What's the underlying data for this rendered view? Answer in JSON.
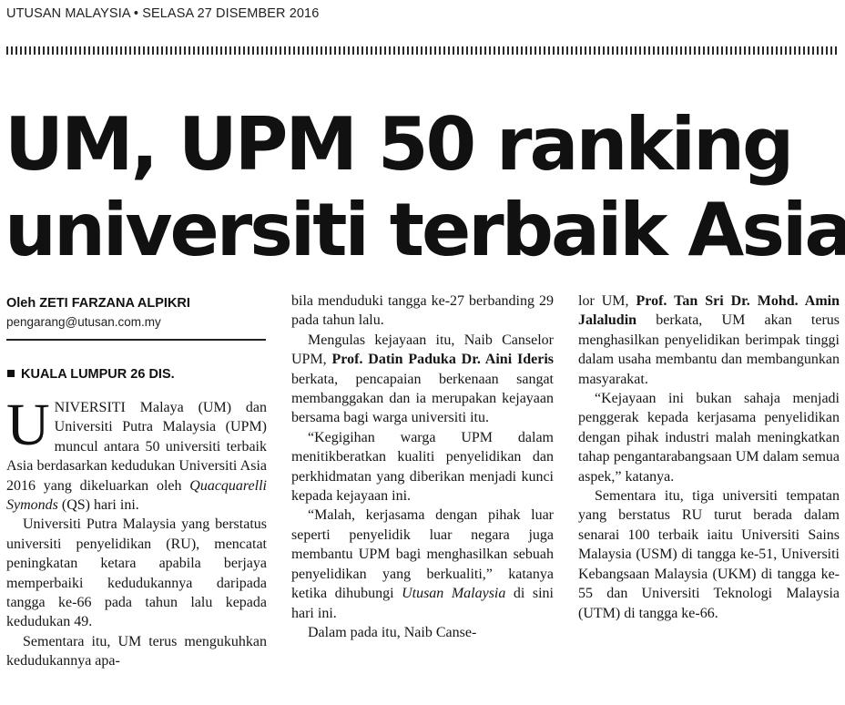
{
  "masthead": "UTUSAN MALAYSIA • SELASA 27 DISEMBER 2016",
  "headline": {
    "line1": "UM, UPM 50 ranking",
    "line2": "universiti terbaik Asia"
  },
  "byline": "Oleh ZETI FARZANA ALPIKRI",
  "email": "pengarang@utusan.com.my",
  "dateline": "KUALA LUMPUR 26 DIS.",
  "col1": {
    "dropcap": "U",
    "p1a": "NIVERSITI Malaya (UM) dan Universiti Putra Malaysia (UPM) muncul antara 50 universiti terbaik Asia berdasarkan kedudukan Universiti Asia 2016 yang dikeluarkan oleh ",
    "p1i": "Quacquarelli Symonds",
    "p1b": " (QS) hari ini.",
    "p2": "Universiti Putra Malaysia yang berstatus universiti penyelidikan (RU), mencatat peningkatan ketara apabila berjaya memperbaiki kedudukannya daripada tangga ke-66 pada tahun lalu kepada kedudukan 49.",
    "p3": "Sementara itu, UM terus mengukuhkan kedudukannya apa-"
  },
  "col2": {
    "p0": "bila menduduki tangga ke-27 berbanding 29 pada tahun lalu.",
    "p1a": "Mengulas kejayaan itu, Naib Canselor UPM, ",
    "p1b": "Prof. Datin Paduka Dr. Aini Ideris",
    "p1c": " berkata, pencapaian berkenaan sangat membanggakan dan ia merupakan kejayaan bersama bagi warga universiti itu.",
    "p2": "“Kegigihan warga UPM dalam menitikberatkan kualiti penyelidikan dan perkhidmatan yang diberikan menjadi kunci kepada kejayaan ini.",
    "p3a": "“Malah, kerjasama dengan pihak luar seperti penyelidik luar negara juga membantu UPM bagi menghasilkan sebuah penyelidikan yang berkualiti,” katanya ketika dihubungi ",
    "p3i": "Utusan Malaysia",
    "p3b": " di sini hari ini.",
    "p4": "Dalam pada itu, Naib Canse-"
  },
  "col3": {
    "p0a": "lor UM, ",
    "p0b": "Prof. Tan Sri Dr. Mohd. Amin Jalaludin",
    "p0c": " berkata, UM akan terus menghasilkan penyelidikan berimpak tinggi dalam usaha membantu dan membangunkan masyarakat.",
    "p1": "“Kejayaan ini bukan sahaja menjadi penggerak kepada kerjasama penyelidikan dengan pihak industri malah meningkatkan tahap pengantarabangsaan UM dalam semua aspek,” katanya.",
    "p2": "Sementara itu, tiga universiti tempatan yang berstatus RU turut berada dalam senarai 100 terbaik iaitu Universiti Sains Malaysia (USM) di tangga ke-51, Universiti Kebangsaan Malaysia (UKM) di tangga ke-55 dan Universiti Teknologi Malaysia (UTM) di tangga ke-66."
  }
}
